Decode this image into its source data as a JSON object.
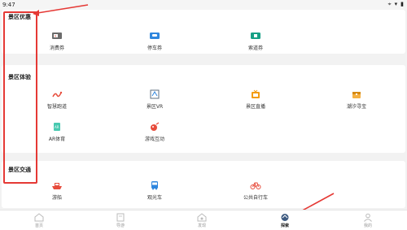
{
  "status": {
    "time": "9:47"
  },
  "sections": {
    "discount": {
      "title": "景区优惠",
      "items": [
        {
          "label": "消费券",
          "icon": "voucher-icon"
        },
        {
          "label": "停车券",
          "icon": "parking-ticket-icon"
        },
        {
          "label": "索道券",
          "icon": "cableway-ticket-icon"
        }
      ]
    },
    "experience": {
      "title": "景区体验",
      "items": [
        {
          "label": "智慧跑道",
          "icon": "running-track-icon"
        },
        {
          "label": "景区VR",
          "icon": "vr-icon"
        },
        {
          "label": "景区直播",
          "icon": "live-tv-icon"
        },
        {
          "label": "潮汐寻宝",
          "icon": "treasure-chest-icon"
        },
        {
          "label": "AR体育",
          "icon": "ar-sports-icon"
        },
        {
          "label": "游戏互动",
          "icon": "game-interaction-icon"
        }
      ]
    },
    "transport": {
      "title": "景区交通",
      "items": [
        {
          "label": "游船",
          "icon": "boat-icon"
        },
        {
          "label": "观光车",
          "icon": "tour-bus-icon"
        },
        {
          "label": "公共自行车",
          "icon": "bicycle-icon"
        }
      ]
    }
  },
  "tabbar": {
    "tabs": [
      {
        "label": "首页",
        "icon": "home-icon"
      },
      {
        "label": "导游",
        "icon": "guide-icon"
      },
      {
        "label": "发现",
        "icon": "discover-icon"
      },
      {
        "label": "探索",
        "icon": "explore-icon",
        "active": true
      },
      {
        "label": "我的",
        "icon": "profile-icon"
      }
    ]
  },
  "colors": {
    "annotation": "#e53935",
    "blue": "#2e86de",
    "teal": "#16a085",
    "red": "#e74c3c",
    "orange": "#f39c12"
  }
}
